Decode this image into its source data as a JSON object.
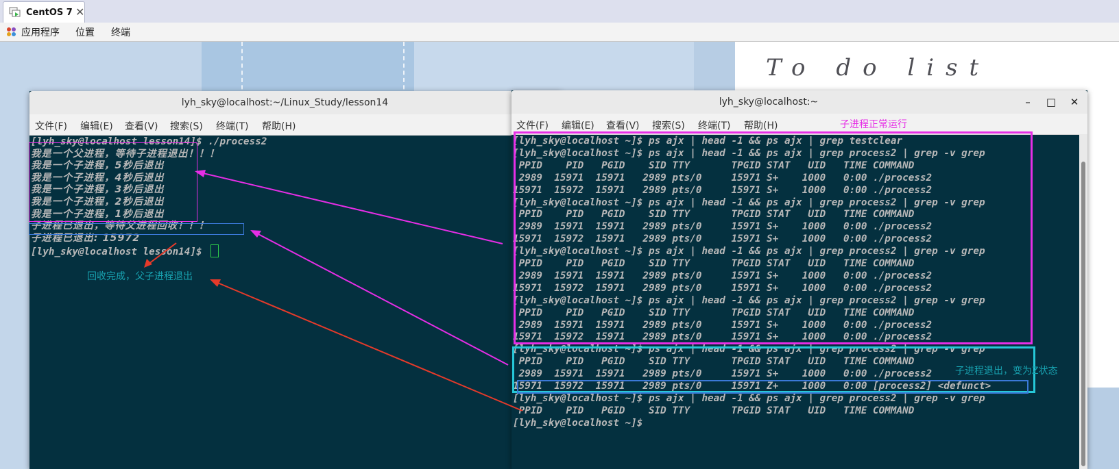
{
  "vm_tab": {
    "title": "CentOS 7",
    "close": "✕"
  },
  "gnome_bar": {
    "applications": "应用程序",
    "places": "位置",
    "terminal": "终端"
  },
  "desktop": {
    "todo_title": "To do list"
  },
  "menu_labels": [
    "文件(F)",
    "编辑(E)",
    "查看(V)",
    "搜索(S)",
    "终端(T)",
    "帮助(H)"
  ],
  "left_terminal": {
    "title": "lyh_sky@localhost:~/Linux_Study/lesson14",
    "lines": [
      "[lyh_sky@localhost lesson14]$ ./process2",
      "我是一个父进程，等待子进程退出！！！",
      "我是一个子进程，5秒后退出",
      "我是一个子进程，4秒后退出",
      "我是一个子进程，3秒后退出",
      "我是一个子进程，2秒后退出",
      "我是一个子进程，1秒后退出",
      "子进程已退出，等待父进程回收！！！",
      "子进程已退出: 15972",
      "[lyh_sky@localhost lesson14]$ "
    ]
  },
  "right_terminal": {
    "title": "lyh_sky@localhost:~",
    "buttons": {
      "minimize": "–",
      "maximize": "□",
      "close": "✕"
    },
    "lines": [
      "[lyh_sky@localhost ~]$ ps ajx | head -1 && ps ajx | grep testclear",
      "[lyh_sky@localhost ~]$ ps ajx | head -1 && ps ajx | grep process2 | grep -v grep",
      " PPID    PID   PGID    SID TTY       TPGID STAT   UID   TIME COMMAND",
      " 2989  15971  15971   2989 pts/0     15971 S+    1000   0:00 ./process2",
      "15971  15972  15971   2989 pts/0     15971 S+    1000   0:00 ./process2",
      "[lyh_sky@localhost ~]$ ps ajx | head -1 && ps ajx | grep process2 | grep -v grep",
      " PPID    PID   PGID    SID TTY       TPGID STAT   UID   TIME COMMAND",
      " 2989  15971  15971   2989 pts/0     15971 S+    1000   0:00 ./process2",
      "15971  15972  15971   2989 pts/0     15971 S+    1000   0:00 ./process2",
      "[lyh_sky@localhost ~]$ ps ajx | head -1 && ps ajx | grep process2 | grep -v grep",
      " PPID    PID   PGID    SID TTY       TPGID STAT   UID   TIME COMMAND",
      " 2989  15971  15971   2989 pts/0     15971 S+    1000   0:00 ./process2",
      "15971  15972  15971   2989 pts/0     15971 S+    1000   0:00 ./process2",
      "[lyh_sky@localhost ~]$ ps ajx | head -1 && ps ajx | grep process2 | grep -v grep",
      " PPID    PID   PGID    SID TTY       TPGID STAT   UID   TIME COMMAND",
      " 2989  15971  15971   2989 pts/0     15971 S+    1000   0:00 ./process2",
      "15971  15972  15971   2989 pts/0     15971 S+    1000   0:00 ./process2",
      "[lyh_sky@localhost ~]$ ps ajx | head -1 && ps ajx | grep process2 | grep -v grep",
      " PPID    PID   PGID    SID TTY       TPGID STAT   UID   TIME COMMAND",
      " 2989  15971  15971   2989 pts/0     15971 S+    1000   0:00 ./process2",
      "15971  15972  15971   2989 pts/0     15971 Z+    1000   0:00 [process2] <defunct>",
      "[lyh_sky@localhost ~]$ ps ajx | head -1 && ps ajx | grep process2 | grep -v grep",
      " PPID    PID   PGID    SID TTY       TPGID STAT   UID   TIME COMMAND",
      "[lyh_sky@localhost ~]$ "
    ]
  },
  "annotations": {
    "child_running": "子进程正常运行",
    "child_zombie": "子进程退出，变为Z状态",
    "reaped": "回收完成，父子进程退出"
  },
  "colors": {
    "terminal_bg": "#04303f",
    "terminal_text": "#b8b8b8",
    "magenta": "#e62ee6",
    "cyan": "#26c8d8",
    "blue": "#3b79d8",
    "red": "#e53a2a",
    "teal_text": "#18a2b0"
  }
}
